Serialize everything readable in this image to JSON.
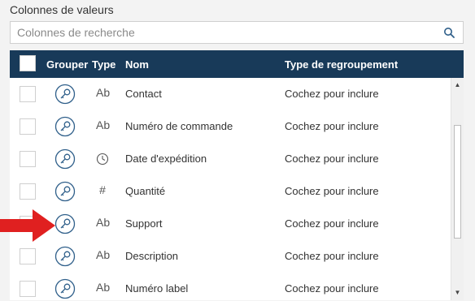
{
  "section_label": "Colonnes de valeurs",
  "search": {
    "placeholder": "Colonnes de recherche",
    "value": "",
    "icon": "search-icon"
  },
  "table": {
    "headers": {
      "group": "Grouper",
      "type": "Type",
      "name": "Nom",
      "grouping_type": "Type de regroupement"
    },
    "rows": [
      {
        "type_icon": "text-type-icon",
        "type_label": "Ab",
        "name": "Contact",
        "grouping": "Cochez pour inclure",
        "checked": false
      },
      {
        "type_icon": "text-type-icon",
        "type_label": "Ab",
        "name": "Numéro de commande",
        "grouping": "Cochez pour inclure",
        "checked": false
      },
      {
        "type_icon": "clock-type-icon",
        "type_label": "",
        "name": "Date d'expédition",
        "grouping": "Cochez pour inclure",
        "checked": false
      },
      {
        "type_icon": "number-type-icon",
        "type_label": "#",
        "name": "Quantité",
        "grouping": "Cochez pour inclure",
        "checked": false
      },
      {
        "type_icon": "text-type-icon",
        "type_label": "Ab",
        "name": "Support",
        "grouping": "Cochez pour inclure",
        "checked": false
      },
      {
        "type_icon": "text-type-icon",
        "type_label": "Ab",
        "name": "Description",
        "grouping": "Cochez pour inclure",
        "checked": false
      },
      {
        "type_icon": "text-type-icon",
        "type_label": "Ab",
        "name": "Numéro label",
        "grouping": "Cochez pour inclure",
        "checked": false
      }
    ]
  },
  "colors": {
    "header_bg": "#183a59",
    "icon_accent": "#2f5f8a",
    "arrow": "#e02020"
  }
}
